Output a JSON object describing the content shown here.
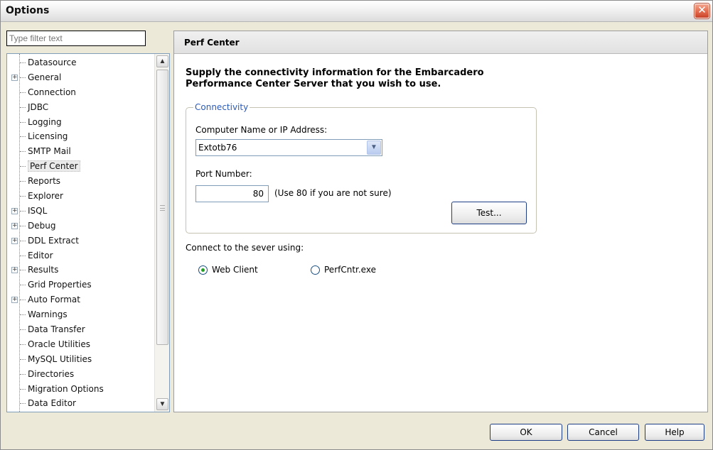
{
  "window": {
    "title": "Options",
    "close_glyph": "✕"
  },
  "filter": {
    "placeholder": "Type filter text"
  },
  "tree": {
    "items": [
      {
        "label": "Datasource",
        "expandable": false
      },
      {
        "label": "General",
        "expandable": true
      },
      {
        "label": "Connection",
        "expandable": false
      },
      {
        "label": "JDBC",
        "expandable": false
      },
      {
        "label": "Logging",
        "expandable": false
      },
      {
        "label": "Licensing",
        "expandable": false
      },
      {
        "label": "SMTP Mail",
        "expandable": false
      },
      {
        "label": "Perf Center",
        "expandable": false,
        "selected": true
      },
      {
        "label": "Reports",
        "expandable": false
      },
      {
        "label": "Explorer",
        "expandable": false
      },
      {
        "label": "ISQL",
        "expandable": true
      },
      {
        "label": "Debug",
        "expandable": true
      },
      {
        "label": "DDL Extract",
        "expandable": true
      },
      {
        "label": "Editor",
        "expandable": false
      },
      {
        "label": "Results",
        "expandable": true
      },
      {
        "label": "Grid Properties",
        "expandable": false
      },
      {
        "label": "Auto Format",
        "expandable": true
      },
      {
        "label": "Warnings",
        "expandable": false
      },
      {
        "label": "Data Transfer",
        "expandable": false
      },
      {
        "label": "Oracle Utilities",
        "expandable": false
      },
      {
        "label": "MySQL Utilities",
        "expandable": false
      },
      {
        "label": "Directories",
        "expandable": false
      },
      {
        "label": "Migration Options",
        "expandable": false
      },
      {
        "label": "Data Editor",
        "expandable": false
      }
    ]
  },
  "panel": {
    "title": "Perf Center",
    "intro_line1": "Supply the connectivity information for the Embarcadero",
    "intro_line2": "Performance Center Server that you wish to use.",
    "group_label": "Connectivity",
    "computer_label": "Computer Name or IP Address:",
    "computer_value": "Extotb76",
    "port_label": "Port Number:",
    "port_value": "80",
    "port_hint": "(Use 80 if you are not sure)",
    "test_label": "Test...",
    "connect_label": "Connect to the sever using:",
    "radio_web": "Web Client",
    "radio_exe": "PerfCntr.exe",
    "selected_option": "Web Client"
  },
  "footer": {
    "ok": "OK",
    "cancel": "Cancel",
    "help": "Help"
  },
  "colors": {
    "accent": "#2b5bbd",
    "close": "#e26b4e"
  }
}
